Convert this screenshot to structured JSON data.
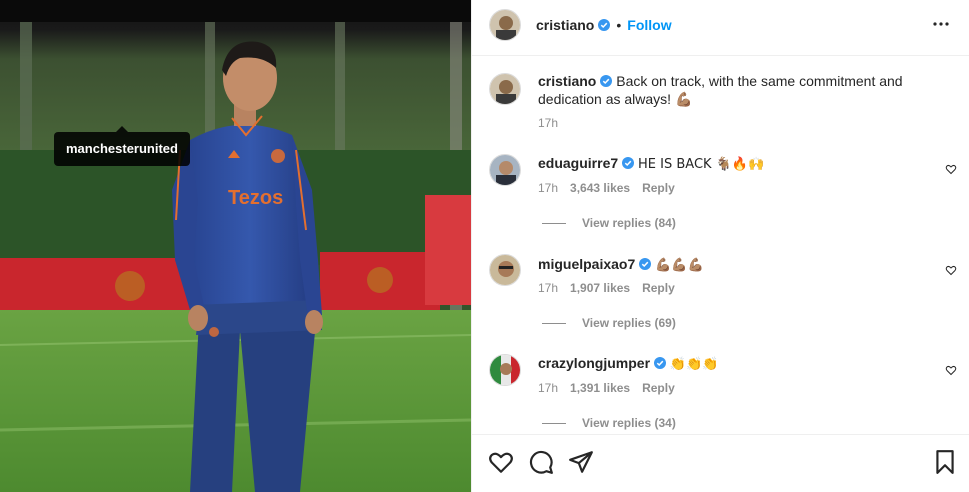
{
  "photo": {
    "tag_label": "manchesterunited",
    "jersey_sponsor": "Tezos",
    "colors": {
      "sky": "#0d0d0d",
      "pitch": "#5c9a3a",
      "hedge": "#2f5a2a",
      "jersey": "#2f4fa0",
      "accent": "#e36f2f",
      "board": "#c8242b"
    }
  },
  "header": {
    "username": "cristiano",
    "separator": "•",
    "follow_label": "Follow"
  },
  "caption": {
    "username": "cristiano",
    "text": "Back on track, with the same commitment and dedication as always! 💪🏽",
    "time": "17h"
  },
  "comments": [
    {
      "username": "eduaguirre7",
      "text": "HE IS BACK 🐐🔥🙌",
      "time": "17h",
      "likes": "3,643 likes",
      "reply_label": "Reply",
      "view_replies": "View replies (84)"
    },
    {
      "username": "miguelpaixao7",
      "text": "💪🏽💪🏽💪🏽",
      "time": "17h",
      "likes": "1,907 likes",
      "reply_label": "Reply",
      "view_replies": "View replies (69)"
    },
    {
      "username": "crazylongjumper",
      "text": "👏👏👏",
      "time": "17h",
      "likes": "1,391 likes",
      "reply_label": "Reply",
      "view_replies": "View replies (34)"
    }
  ],
  "icons": {
    "header_more": "more-options-icon",
    "verified": "verified-badge-icon",
    "like": "heart-icon",
    "comment": "comment-icon",
    "share": "share-icon",
    "save": "bookmark-icon"
  },
  "accent_color": "#0095f6",
  "verified_color": "#3897f0"
}
